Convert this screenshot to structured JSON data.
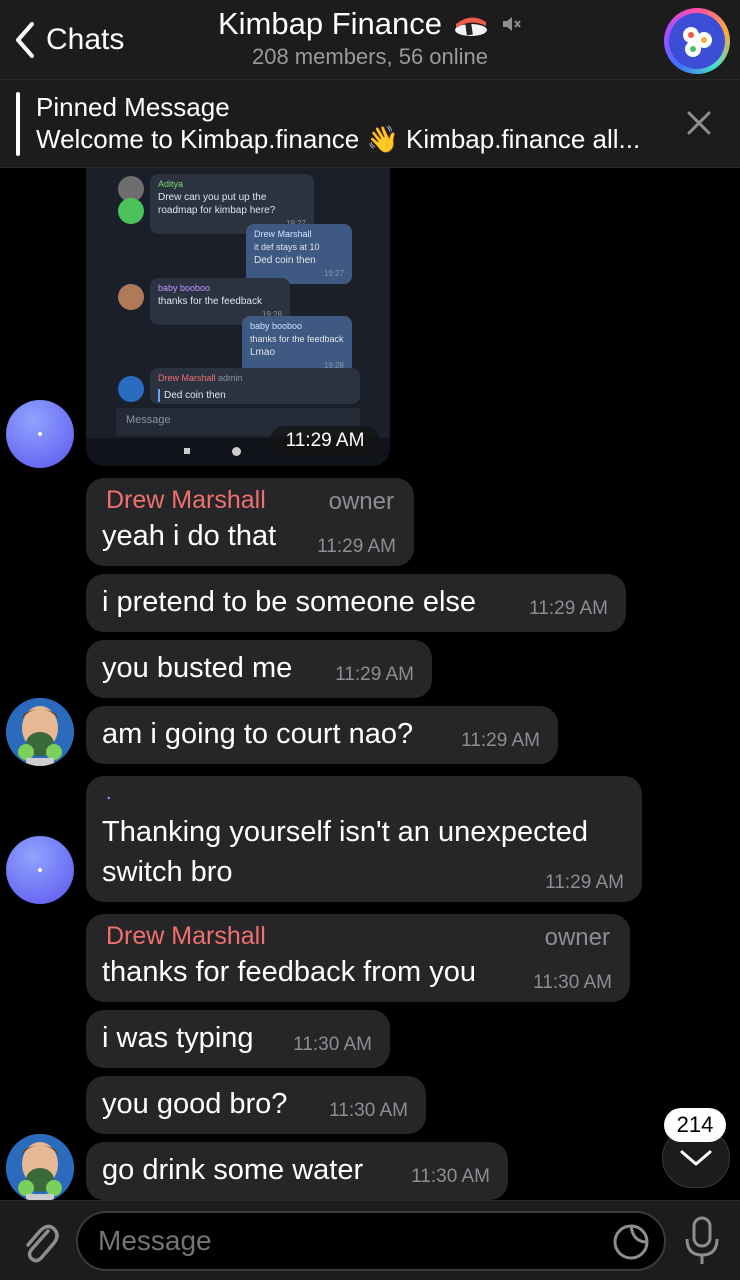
{
  "header": {
    "back_label": "Chats",
    "title": "Kimbap Finance",
    "subtitle": "208 members, 56 online"
  },
  "pinned": {
    "title": "Pinned Message",
    "text": "Welcome to Kimbap.finance 👋 Kimbap.finance all..."
  },
  "image_message": {
    "time": "11:29 AM",
    "screenshot": {
      "msg1_name": "Aditya",
      "msg1_text": "Drew can you put up the roadmap for kimbap here?",
      "msg1_time": "19:27",
      "msg2_name": "Drew Marshall",
      "msg2_quote": "it def stays at 10",
      "msg2_text": "Ded coin then",
      "msg2_time": "19:27",
      "msg3_name": "baby booboo",
      "msg3_text": "thanks for the feedback",
      "msg3_time": "19:28",
      "msg4_name": "baby booboo",
      "msg4_quote": "thanks for the feedback",
      "msg4_text": "Lmao",
      "msg4_time": "19:28",
      "msg5_name": "Drew Marshall",
      "msg5_role": "admin",
      "msg5_text": "Ded coin then",
      "input_placeholder": "Message"
    }
  },
  "messages": [
    {
      "sender": "Drew Marshall",
      "role": "owner",
      "text": "yeah i do that",
      "time": "11:29 AM"
    },
    {
      "text": "i pretend to be someone else",
      "time": "11:29 AM"
    },
    {
      "text": "you busted me",
      "time": "11:29 AM"
    },
    {
      "text": "am i going to court nao?",
      "time": "11:29 AM"
    },
    {
      "sender": ".",
      "text": "Thanking yourself isn't an unexpected switch bro",
      "line1": "Thanking yourself isn't an unexpected",
      "line2": "switch bro",
      "time": "11:29 AM"
    },
    {
      "sender": "Drew Marshall",
      "role": "owner",
      "text": "thanks for feedback from you",
      "time": "11:30 AM"
    },
    {
      "text": "i was typing",
      "time": "11:30 AM"
    },
    {
      "text": "you good bro?",
      "time": "11:30 AM"
    },
    {
      "text": "go drink some water",
      "time": "11:30 AM"
    }
  ],
  "scroll": {
    "unread_count": "214"
  },
  "input": {
    "placeholder": "Message"
  },
  "colors": {
    "sender_name": "#f07070",
    "bubble": "#262628",
    "accent_avatar": "#5c55ee"
  }
}
